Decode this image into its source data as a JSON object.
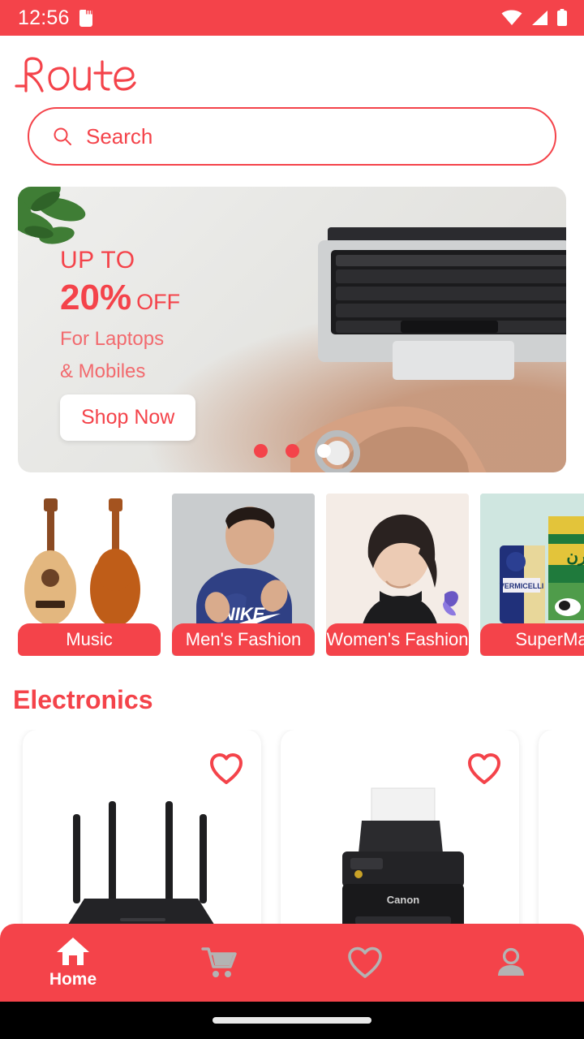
{
  "status_bar": {
    "time": "12:56",
    "icons": [
      "sd-card-icon",
      "wifi-icon",
      "cellular-signal-icon",
      "battery-icon"
    ],
    "background": "#f4434a"
  },
  "header": {
    "logo_text": "Route",
    "logo_color": "#f4434a"
  },
  "search": {
    "placeholder": "Search",
    "icon": "search-icon",
    "border_color": "#f4434a"
  },
  "banner": {
    "line1": "UP TO",
    "discount": "20%",
    "off": "OFF",
    "line3": "For Laptops",
    "line4": "& Mobiles",
    "cta_label": "Shop Now",
    "dots": [
      {
        "active": false
      },
      {
        "active": false
      },
      {
        "active": true
      }
    ],
    "image_description": "laptop-on-desk-photo"
  },
  "categories": [
    {
      "label": "Music",
      "art": "guitars"
    },
    {
      "label": "Men's Fashion",
      "art": "man-nike-hoodie"
    },
    {
      "label": "Women's Fashion",
      "art": "woman-illustration"
    },
    {
      "label": "SuperMa",
      "art": "grocery-products"
    }
  ],
  "sections": [
    {
      "title": "Electronics",
      "products": [
        {
          "art": "wifi-router",
          "favorite_icon": "heart-outline-icon"
        },
        {
          "art": "canon-printer",
          "favorite_icon": "heart-outline-icon"
        },
        {
          "art": "partial-card",
          "favorite_icon": "heart-outline-icon"
        }
      ]
    }
  ],
  "bottom_nav": {
    "background": "#f4434a",
    "active_color": "#ffffff",
    "inactive_color": "#b3b3b3",
    "items": [
      {
        "label": "Home",
        "icon": "home-icon",
        "active": true
      },
      {
        "label": "",
        "icon": "cart-icon",
        "active": false
      },
      {
        "label": "",
        "icon": "heart-icon",
        "active": false
      },
      {
        "label": "",
        "icon": "profile-icon",
        "active": false
      }
    ]
  },
  "colors": {
    "brand_red": "#f4434a",
    "banner_subtext": "#f26a6e",
    "nav_inactive": "#b3b3b3"
  }
}
